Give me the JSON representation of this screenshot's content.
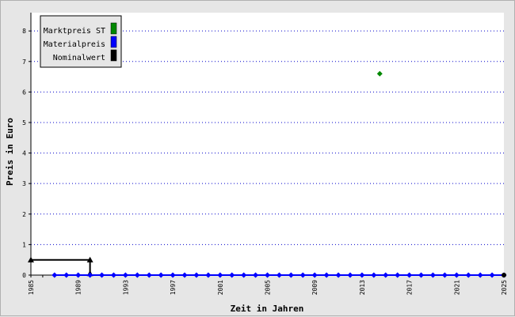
{
  "chart_data": {
    "type": "line",
    "xlabel": "Zeit in Jahren",
    "ylabel": "Preis in Euro",
    "xlim": [
      1985,
      2025
    ],
    "ylim": [
      0,
      8.6
    ],
    "x_ticks": [
      "1985",
      "1989",
      "1993",
      "1997",
      "2001",
      "2005",
      "2009",
      "2013",
      "2017",
      "2021",
      "2025"
    ],
    "y_ticks": [
      "0",
      "1",
      "2",
      "3",
      "4",
      "5",
      "6",
      "7",
      "8"
    ],
    "grid": "horizontal-dotted",
    "legend_position": "top-left",
    "colors": {
      "marktpreis": "#008800",
      "materialpreis": "#0000ff",
      "nominalwert": "#000000",
      "grid": "#0000cc"
    },
    "series": [
      {
        "name": "Marktpreis ST",
        "marker": "diamond",
        "points": [
          [
            2014.5,
            6.6
          ]
        ]
      },
      {
        "name": "Materialpreis",
        "marker": "diamond",
        "points": [
          [
            1987,
            0
          ],
          [
            1988,
            0
          ],
          [
            1989,
            0
          ],
          [
            1990,
            0
          ],
          [
            1991,
            0
          ],
          [
            1992,
            0
          ],
          [
            1993,
            0
          ],
          [
            1994,
            0
          ],
          [
            1995,
            0
          ],
          [
            1996,
            0
          ],
          [
            1997,
            0
          ],
          [
            1998,
            0
          ],
          [
            1999,
            0
          ],
          [
            2000,
            0
          ],
          [
            2001,
            0
          ],
          [
            2002,
            0
          ],
          [
            2003,
            0
          ],
          [
            2004,
            0
          ],
          [
            2005,
            0
          ],
          [
            2006,
            0
          ],
          [
            2007,
            0
          ],
          [
            2008,
            0
          ],
          [
            2009,
            0
          ],
          [
            2010,
            0
          ],
          [
            2011,
            0
          ],
          [
            2012,
            0
          ],
          [
            2013,
            0
          ],
          [
            2014,
            0
          ],
          [
            2015,
            0
          ],
          [
            2016,
            0
          ],
          [
            2017,
            0
          ],
          [
            2018,
            0
          ],
          [
            2019,
            0
          ],
          [
            2020,
            0
          ],
          [
            2021,
            0
          ],
          [
            2022,
            0
          ],
          [
            2023,
            0
          ],
          [
            2024,
            0
          ],
          [
            2025,
            0
          ]
        ]
      },
      {
        "name": "Nominalwert",
        "marker": "triangle",
        "points": [
          [
            1985,
            0.5
          ],
          [
            1990,
            0.5
          ],
          [
            1990,
            0
          ],
          [
            2025,
            0
          ]
        ]
      }
    ]
  }
}
